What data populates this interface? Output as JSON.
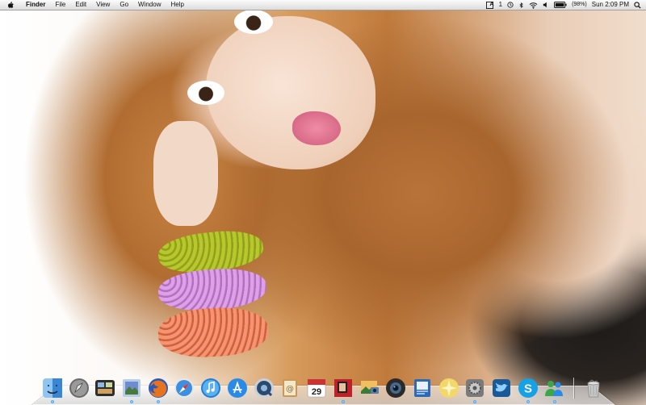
{
  "menubar": {
    "active_app": "Finder",
    "menus": [
      "File",
      "Edit",
      "View",
      "Go",
      "Window",
      "Help"
    ],
    "status": {
      "input_indicator": "A",
      "notification_count": "1",
      "battery_percent": "(98%)",
      "clock": "Sun 2:09 PM"
    }
  },
  "dock": {
    "items": [
      {
        "name": "finder-icon",
        "color": "#4a9be0"
      },
      {
        "name": "launchpad-icon",
        "color": "#8a8a8a"
      },
      {
        "name": "mission-control-icon",
        "color": "#3b3b3b"
      },
      {
        "name": "preview-icon",
        "color": "#6e8ccf"
      },
      {
        "name": "firefox-icon",
        "color": "#e8731e"
      },
      {
        "name": "safari-icon",
        "color": "#3d8fe0"
      },
      {
        "name": "itunes-icon",
        "color": "#1e7fd8"
      },
      {
        "name": "app-store-icon",
        "color": "#2a8ae8"
      },
      {
        "name": "quicktime-icon",
        "color": "#2b4a6e"
      },
      {
        "name": "address-book-icon",
        "color": "#c89858"
      },
      {
        "name": "calendar-icon",
        "color": "#ffffff",
        "label": "29"
      },
      {
        "name": "photo-booth-icon",
        "color": "#c0202a"
      },
      {
        "name": "iphoto-icon",
        "color": "#5b7ea8"
      },
      {
        "name": "facetime-icon",
        "color": "#2a2a2a"
      },
      {
        "name": "preview-document-icon",
        "color": "#2a6ab8"
      },
      {
        "name": "dashboard-icon",
        "color": "#f2d86a"
      },
      {
        "name": "system-preferences-icon",
        "color": "#7a7a7a"
      },
      {
        "name": "twitter-icon",
        "color": "#3a9de0"
      },
      {
        "name": "skype-icon",
        "color": "#16a0e6"
      },
      {
        "name": "messenger-icon",
        "color": "#3aa848"
      }
    ],
    "trash": {
      "name": "trash-icon",
      "color": "#b8b8b8"
    }
  }
}
